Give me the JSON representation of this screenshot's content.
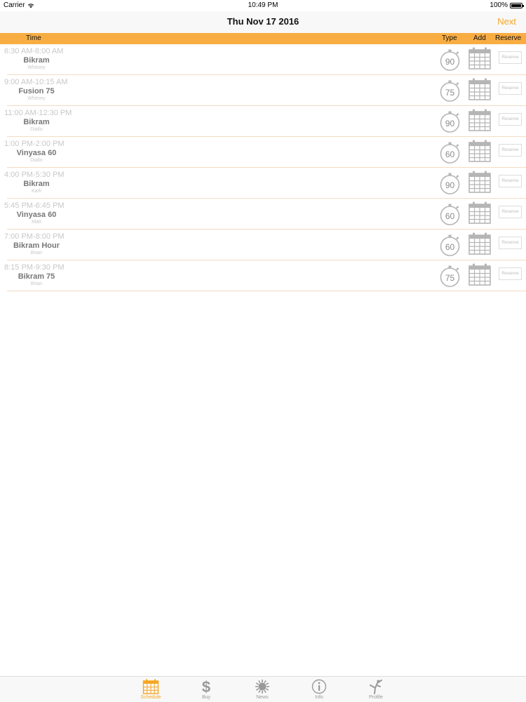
{
  "status_bar": {
    "carrier": "Carrier",
    "time": "10:49 PM",
    "battery": "100%"
  },
  "nav": {
    "title": "Thu Nov 17 2016",
    "next_label": "Next"
  },
  "table_header": {
    "time": "Time",
    "type": "Type",
    "add": "Add",
    "reserve": "Reserve"
  },
  "colors": {
    "accent": "#f5a623",
    "header_bar": "#f8ad43"
  },
  "classes": [
    {
      "time": "6:30 AM-8:00 AM",
      "name": "Bikram",
      "instructor": "Whitney",
      "duration": "90",
      "reserve_label": "Reserve"
    },
    {
      "time": "9:00 AM-10:15 AM",
      "name": "Fusion 75",
      "instructor": "Whitney",
      "duration": "75",
      "reserve_label": "Reserve"
    },
    {
      "time": "11:00 AM-12:30 PM",
      "name": "Bikram",
      "instructor": "Diallo",
      "duration": "90",
      "reserve_label": "Reserve"
    },
    {
      "time": "1:00 PM-2:00 PM",
      "name": "Vinyasa 60",
      "instructor": "Diallo",
      "duration": "60",
      "reserve_label": "Reserve"
    },
    {
      "time": "4:00 PM-5:30 PM",
      "name": "Bikram",
      "instructor": "Karli",
      "duration": "90",
      "reserve_label": "Reserve"
    },
    {
      "time": "5:45 PM-6:45 PM",
      "name": "Vinyasa 60",
      "instructor": "Matt",
      "duration": "60",
      "reserve_label": "Reserve"
    },
    {
      "time": "7:00 PM-8:00 PM",
      "name": "Bikram Hour",
      "instructor": "Brian",
      "duration": "60",
      "reserve_label": "Reserve"
    },
    {
      "time": "8:15 PM-9:30 PM",
      "name": "Bikram 75",
      "instructor": "Brian",
      "duration": "75",
      "reserve_label": "Reserve"
    }
  ],
  "tabs": [
    {
      "label": "Schedule",
      "icon": "calendar-icon",
      "active": true
    },
    {
      "label": "Buy",
      "icon": "dollar-icon",
      "active": false
    },
    {
      "label": "News",
      "icon": "sun-icon",
      "active": false
    },
    {
      "label": "Info",
      "icon": "info-icon",
      "active": false
    },
    {
      "label": "Profile",
      "icon": "yoga-pose-icon",
      "active": false
    }
  ]
}
